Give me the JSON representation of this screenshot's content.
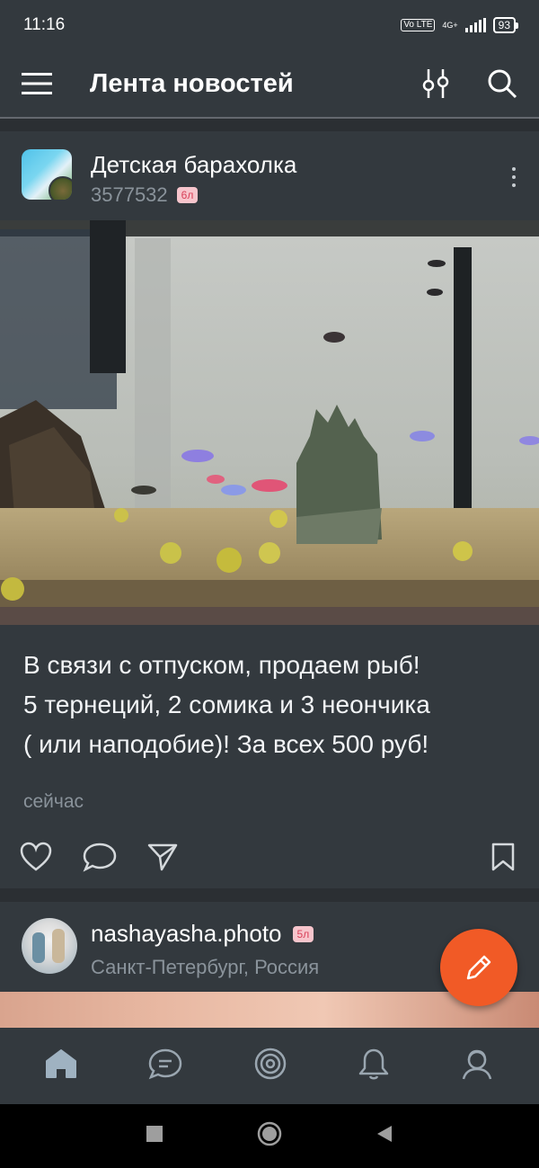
{
  "status_bar": {
    "time": "11:16",
    "volte": "Vo LTE",
    "network": "4G+",
    "battery": "93"
  },
  "app_bar": {
    "title": "Лента новостей",
    "menu_icon": "hamburger-icon",
    "filter_icon": "sliders-icon",
    "search_icon": "search-icon"
  },
  "post1": {
    "group_name": "Детская барахолка",
    "members": "3577532",
    "age_badge": "6л",
    "text_lines": [
      "В связи с отпуском, продаем рыб!",
      "5 тернеций, 2 сомика и 3 неончика",
      "( или наподобие)! За всех 500 руб!"
    ],
    "time": "сейчас"
  },
  "post2": {
    "name": "nashayasha.photo",
    "age_badge": "5л",
    "location": "Санкт-Петербург, Россия"
  },
  "tabs": [
    {
      "icon": "home-icon"
    },
    {
      "icon": "messages-icon"
    },
    {
      "icon": "discover-icon"
    },
    {
      "icon": "bell-icon"
    },
    {
      "icon": "profile-icon"
    }
  ],
  "colors": {
    "background": "#2b2f33",
    "card": "#33393e",
    "fab": "#f15a26",
    "muted_text": "#8a939b",
    "badge_bg": "#f7c5cc",
    "badge_text": "#d9425a"
  }
}
